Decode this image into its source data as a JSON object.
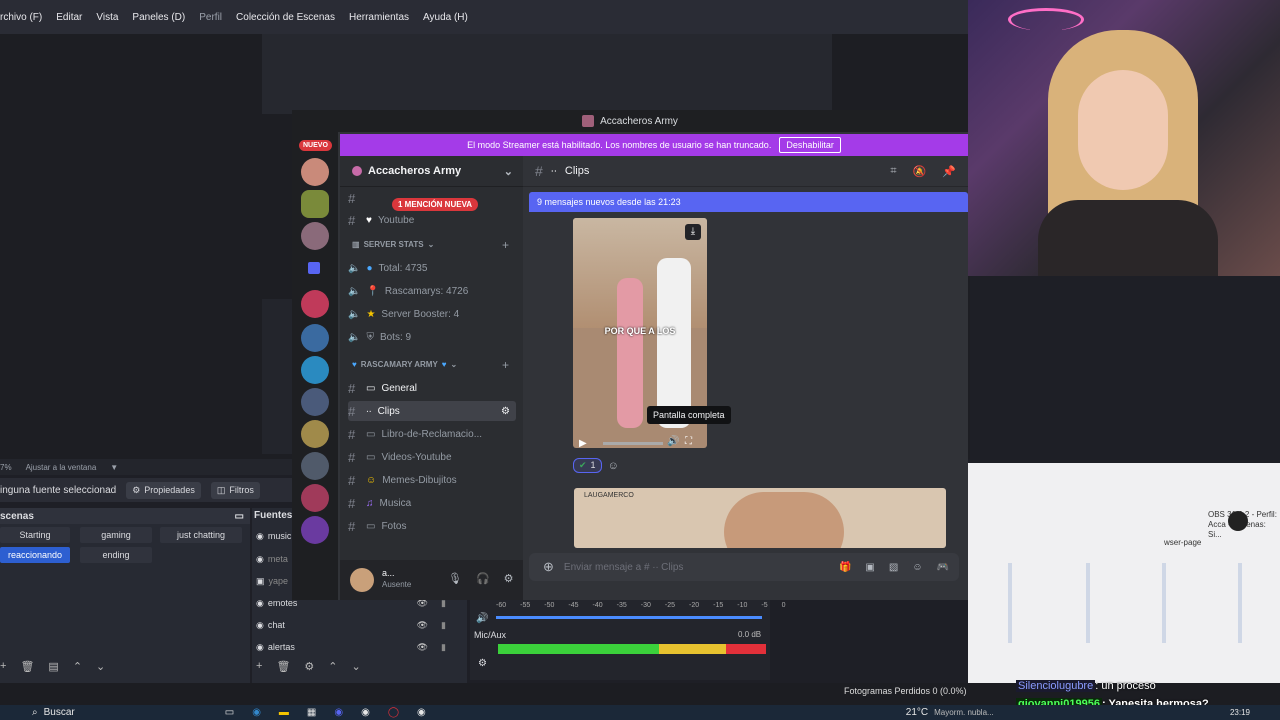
{
  "obs": {
    "menu": [
      "rchivo (F)",
      "Editar",
      "Vista",
      "Paneles (D)",
      "Perfil",
      "Colección de Escenas",
      "Herramientas",
      "Ayuda (H)"
    ],
    "zoom": "7%",
    "fit_label": "Ajustar a la ventana",
    "no_source": "inguna fuente seleccionad",
    "properties_label": "Propiedades",
    "filters_label": "Filtros",
    "scenes_title": "scenas",
    "scenes": [
      "Starting",
      "gaming",
      "just chatting",
      "reaccionando",
      "ending"
    ],
    "sources_title": "Fuentes",
    "sources": [
      "music",
      "meta",
      "yape",
      "emotes",
      "chat",
      "alertas"
    ],
    "mixer": {
      "ticks": [
        "-60",
        "-55",
        "-50",
        "-45",
        "-40",
        "-35",
        "-30",
        "-25",
        "-20",
        "-15",
        "-10",
        "-5",
        "0"
      ],
      "mic_label": "Mic/Aux",
      "mic_db": "0.0 dB"
    },
    "status_dropped": "Fotogramas Perdidos 0 (0.0%)",
    "right_panel": {
      "browser_label": "wser-page",
      "obs_title": "OBS 31.0.2 - Perfil: Acca - Escenas: Si..."
    }
  },
  "discord": {
    "window_title": "Accacheros Army",
    "new_badge": "NUEVO",
    "streamer_banner": "El modo Streamer está habilitado. Los nombres de usuario se han truncado.",
    "disable_button": "Deshabilitar",
    "server_name": "Accacheros Army",
    "mention_pill": "1 MENCIÓN NUEVA",
    "channels_top": [
      "Youtube"
    ],
    "category_stats": "SERVER STATS",
    "stats": [
      "Total: 4735",
      "Rascamarys: 4726",
      "Server Booster: 4",
      "Bots: 9"
    ],
    "category_army": "RASCAMARY ARMY",
    "channels": [
      "General",
      "Clips",
      "Libro-de-Reclamacio...",
      "Videos-Youtube",
      "Memes-Dibujitos",
      "Musica",
      "Fotos"
    ],
    "channel_title": "Clips",
    "new_messages": "9 mensajes nuevos desde las 21:23",
    "video_caption": "POR QUE A LOS",
    "tooltip": "Pantalla completa",
    "reaction_count": "1",
    "video2_label": "LAUGAMERCO",
    "composer_placeholder": "Enviar mensaje a # ·∙ Clips",
    "user_status": "Ausente",
    "user_name": "a..."
  },
  "chat_overlay": [
    {
      "user": "Silenciolugubre",
      "text": ": un proceso",
      "color": "#8a9bff"
    },
    {
      "user": "giovanni019956",
      "text": ": Yanesita hermosa?",
      "color": "#4dff5a"
    }
  ],
  "taskbar": {
    "search": "Buscar",
    "weather": "21°C",
    "weather_desc": "Mayorm. nubla...",
    "time": "23:19"
  }
}
